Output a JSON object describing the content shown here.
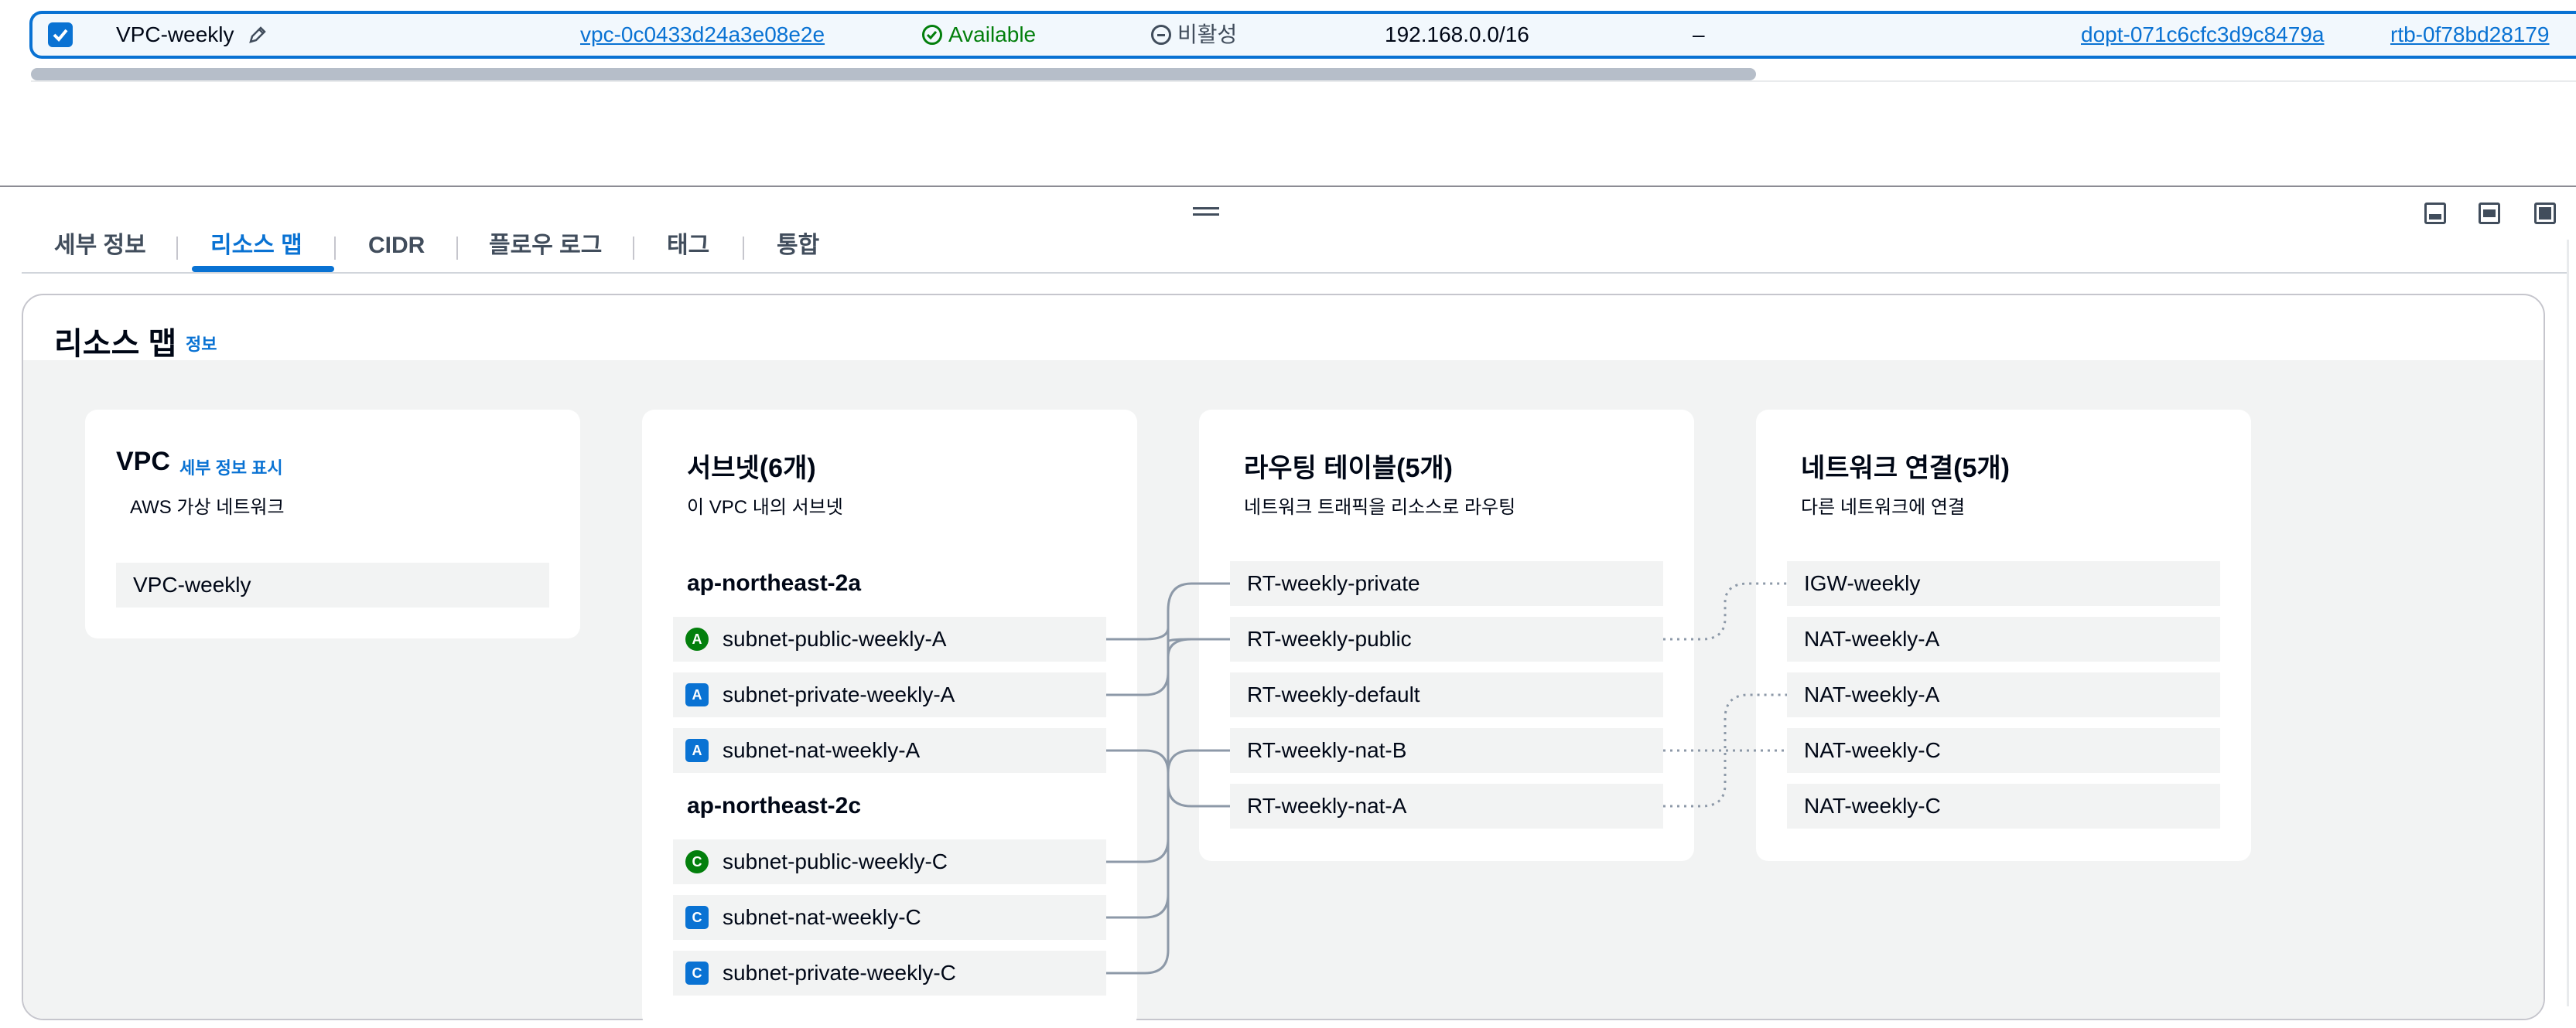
{
  "table_row": {
    "name": "VPC-weekly",
    "vpc_id": "vpc-0c0433d24a3e08e2e",
    "state": "Available",
    "block_public_access": "비활성",
    "ipv4_cidr": "192.168.0.0/16",
    "ipv6_cidr": "–",
    "dhcp_options": "dopt-071c6cfc3d9c8479a",
    "route_table": "rtb-0f78bd28179"
  },
  "tabs": [
    "세부 정보",
    "리소스 맵",
    "CIDR",
    "플로우 로그",
    "태그",
    "통합"
  ],
  "resource_map": {
    "title": "리소스 맵",
    "info_link": "정보",
    "vpc": {
      "title": "VPC",
      "details_link": "세부 정보 표시",
      "subtitle": "AWS 가상 네트워크",
      "items": [
        "VPC-weekly"
      ]
    },
    "subnets": {
      "title": "서브넷(6개)",
      "subtitle": "이 VPC 내의 서브넷",
      "zones": [
        {
          "name": "ap-northeast-2a",
          "items": [
            {
              "badge": "A",
              "kind": "public",
              "label": "subnet-public-weekly-A"
            },
            {
              "badge": "A",
              "kind": "private",
              "label": "subnet-private-weekly-A"
            },
            {
              "badge": "A",
              "kind": "private",
              "label": "subnet-nat-weekly-A"
            }
          ]
        },
        {
          "name": "ap-northeast-2c",
          "items": [
            {
              "badge": "C",
              "kind": "public",
              "label": "subnet-public-weekly-C"
            },
            {
              "badge": "C",
              "kind": "private",
              "label": "subnet-nat-weekly-C"
            },
            {
              "badge": "C",
              "kind": "private",
              "label": "subnet-private-weekly-C"
            }
          ]
        }
      ]
    },
    "route_tables": {
      "title": "라우팅 테이블(5개)",
      "subtitle": "네트워크 트래픽을 리소스로 라우팅",
      "items": [
        "RT-weekly-private",
        "RT-weekly-public",
        "RT-weekly-default",
        "RT-weekly-nat-B",
        "RT-weekly-nat-A"
      ]
    },
    "network_connections": {
      "title": "네트워크 연결(5개)",
      "subtitle": "다른 네트워크에 연결",
      "items": [
        "IGW-weekly",
        "NAT-weekly-A",
        "NAT-weekly-A",
        "NAT-weekly-C",
        "NAT-weekly-C"
      ]
    }
  },
  "colors": {
    "accent": "#0972d3",
    "success": "#037f0c",
    "connector": "#8d99a8"
  }
}
